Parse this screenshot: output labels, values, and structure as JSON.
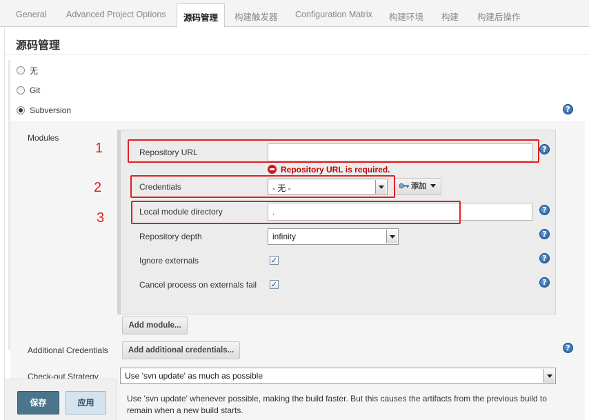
{
  "tabs": [
    {
      "label": "General"
    },
    {
      "label": "Advanced Project Options"
    },
    {
      "label": "源码管理"
    },
    {
      "label": "构建触发器"
    },
    {
      "label": "Configuration Matrix"
    },
    {
      "label": "构建环境"
    },
    {
      "label": "构建"
    },
    {
      "label": "构建后操作"
    }
  ],
  "active_tab": "源码管理",
  "section_title": "源码管理",
  "scm_options": [
    {
      "label": "无",
      "checked": false
    },
    {
      "label": "Git",
      "checked": false
    },
    {
      "label": "Subversion",
      "checked": true
    }
  ],
  "help_glyph": "?",
  "modules_label": "Modules",
  "module": {
    "repository_url_label": "Repository URL",
    "repository_url_value": "",
    "error_text": "Repository URL is required.",
    "credentials_label": "Credentials",
    "credentials_value": "- 无 -",
    "add_button_label": "添加",
    "local_dir_label": "Local module directory",
    "local_dir_value": ".",
    "depth_label": "Repository depth",
    "depth_value": "infinity",
    "ignore_externals_label": "Ignore externals",
    "ignore_externals_checked": true,
    "cancel_externals_label": "Cancel process on externals fail",
    "cancel_externals_checked": true
  },
  "add_module_label": "Add module...",
  "additional_credentials_label": "Additional Credentials",
  "add_additional_credentials_label": "Add additional credentials...",
  "checkout_strategy_label": "Check-out Strategy",
  "checkout_strategy_value": "Use 'svn update' as much as possible",
  "checkout_strategy_description": "Use 'svn update' whenever possible, making the build faster. But this causes the artifacts from the previous build to remain when a new build starts.",
  "annotations": [
    "1",
    "2",
    "3"
  ],
  "buttons": {
    "save": "保存",
    "apply": "应用"
  },
  "check_glyph": "✓",
  "colors": {
    "annotation_red": "#e02020",
    "error_red": "#c40000",
    "save_blue": "#4b758b",
    "help_blue": "#1f5c9e"
  }
}
